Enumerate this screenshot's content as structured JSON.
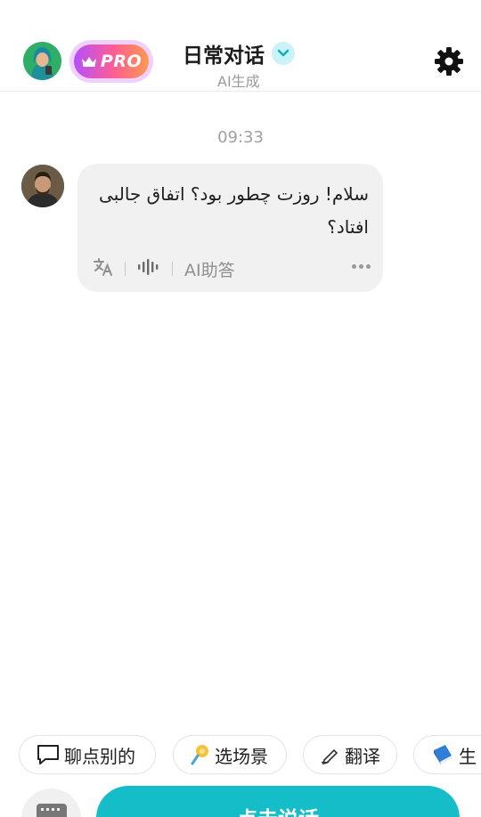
{
  "header": {
    "pro_label": "PRO",
    "title": "日常对话",
    "subtitle": "AI生成",
    "icons": {
      "avatar": "user-avatar",
      "crown": "crown-icon",
      "chevron": "chevron-down-icon",
      "settings": "gear-icon"
    }
  },
  "chat": {
    "timestamp": "09:33",
    "messages": [
      {
        "text": "سلام! روزت چطور بود؟ اتفاق جالبی افتاد؟",
        "ai_answer_label": "AI助答",
        "tools": [
          "translate-icon",
          "audio-wave-icon",
          "more-icon"
        ]
      }
    ]
  },
  "chips": [
    {
      "label": "聊点别的",
      "icon": "speech-bubble-icon"
    },
    {
      "label": "选场景",
      "icon": "pin-icon"
    },
    {
      "label": "翻译",
      "icon": "pen-icon"
    },
    {
      "label": "生",
      "icon": "book-icon"
    }
  ],
  "bottom": {
    "talk_label": "点击说话",
    "keyboard_icon": "keyboard-icon"
  },
  "colors": {
    "accent": "#15bdc9",
    "pro_gradient_start": "#b44fff",
    "pro_gradient_end": "#ff9a52",
    "bubble_bg": "#f1f1f1"
  }
}
